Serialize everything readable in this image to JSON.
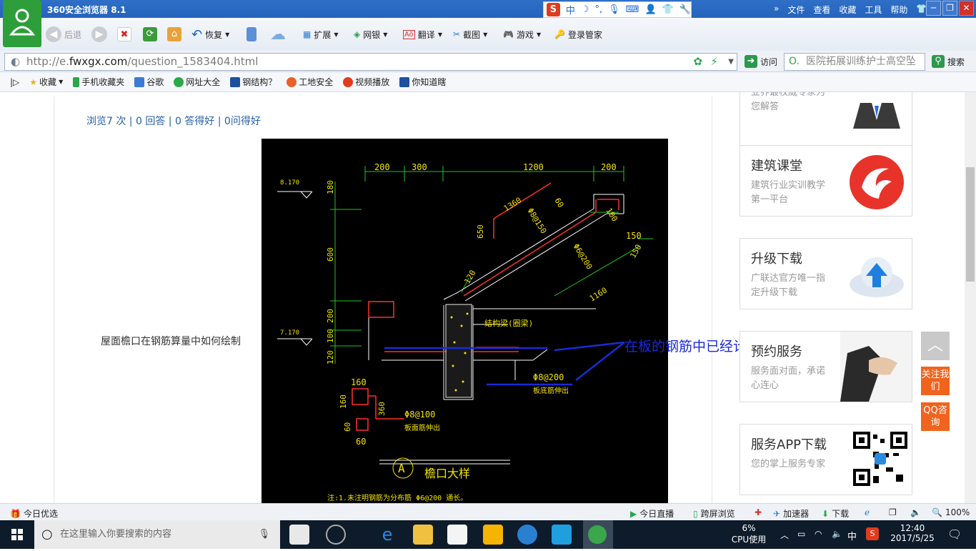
{
  "window": {
    "title": "360安全浏览器 8.1",
    "menus": [
      "文件",
      "查看",
      "收藏",
      "工具",
      "帮助"
    ],
    "ime_label": "中"
  },
  "toolbar": {
    "back": "后退",
    "restore": "恢复",
    "extensions": "扩展",
    "netbank": "网银",
    "translate": "翻译",
    "screenshot": "截图",
    "games": "游戏",
    "login_manager": "登录管家"
  },
  "address_bar": {
    "prefix": "http://e.",
    "domain": "fwxgx.com",
    "path": "/question_1583404.html",
    "visit_label": "访问",
    "search_placeholder": "医院拓展训练护士高空坠",
    "search_label": "搜索"
  },
  "favorites": [
    "收藏",
    "手机收藏夹",
    "谷歌",
    "网址大全",
    "钢结构？",
    "工地安全",
    "视频播放",
    "你知道瞎"
  ],
  "page": {
    "stats": "浏览7 次 | 0 回答 | 0 答得好 | 0问得好",
    "question": "屋面檐口在钢筋算量中如何绘制",
    "annotation": "在板的钢筋中已经计算",
    "drawing": {
      "dims_top": [
        "200",
        "300",
        "1200",
        "200"
      ],
      "elev_top": "8.170",
      "elev_mid": "7.170",
      "left_dims": [
        "180",
        "600",
        "200",
        "100",
        "120"
      ],
      "rebar_1360": "1360",
      "rebar_60": "60",
      "rebar_650": "650",
      "rebar_phi8_150": "Φ8@150",
      "rebar_phi6_200": "Φ6@200",
      "dim_100": "100",
      "dim_150a": "150",
      "dim_150b": "150",
      "dim_1160": "1160",
      "dim_120": "120",
      "beam_label": "结构梁(圈梁)",
      "phi8_200": "Φ8@200",
      "slab_bottom": "板底筋伸出",
      "dim_160a": "160",
      "dim_160b": "160",
      "dim_360": "360",
      "dim_60": "60",
      "dim_60b": "60",
      "phi8_100": "Φ8@100",
      "slab_top": "板面筋伸出",
      "detail_id": "A",
      "detail_title": "檐口大样",
      "note": "注:1.未注明钢筋为分布筋 Φ6@200 通长。"
    }
  },
  "sidebar": {
    "cards": [
      {
        "title": "",
        "desc": "业界最权威专家为您解答"
      },
      {
        "title": "建筑课堂",
        "desc": "建筑行业实训教学第一平台"
      },
      {
        "title": "升级下载",
        "desc": "广联达官方唯一指定升级下载"
      },
      {
        "title": "预约服务",
        "desc": "服务面对面，承诺心连心"
      },
      {
        "title": "服务APP下载",
        "desc": "您的掌上服务专家"
      }
    ],
    "follow": "关注我们",
    "qq": "QQ咨询"
  },
  "statusbar": {
    "today_pick": "今日优选",
    "today_live": "今日直播",
    "cross_screen": "跨屏浏览",
    "accelerator": "加速器",
    "download": "下载",
    "zoom": "100%"
  },
  "taskbar": {
    "search_placeholder": "在这里输入你要搜索的内容",
    "cpu_percent": "6%",
    "cpu_label": "CPU使用",
    "ime": "中",
    "time": "12:40",
    "date": "2017/5/25"
  }
}
